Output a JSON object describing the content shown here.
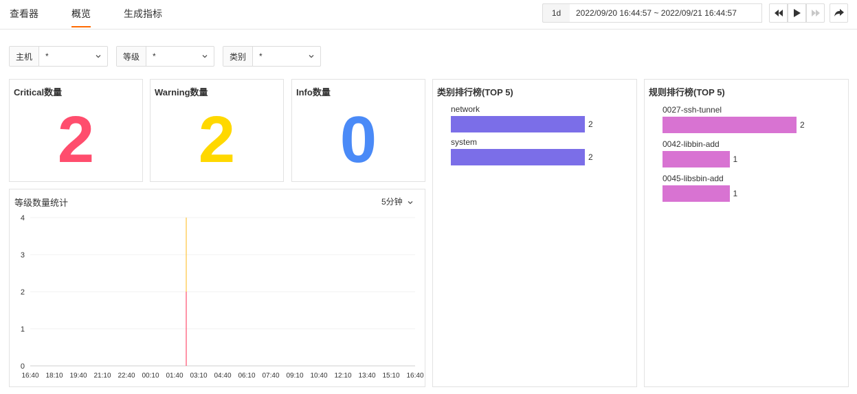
{
  "tabs": [
    {
      "label": "查看器"
    },
    {
      "label": "概览"
    },
    {
      "label": "生成指标"
    }
  ],
  "time_range": {
    "quick": "1d",
    "range_text": "2022/09/20 16:44:57 ~ 2022/09/21 16:44:57"
  },
  "filters": [
    {
      "label": "主机",
      "value": "*"
    },
    {
      "label": "等级",
      "value": "*"
    },
    {
      "label": "类别",
      "value": "*"
    }
  ],
  "stats": [
    {
      "title": "Critical数量",
      "value": "2",
      "color": "#ff4d6d"
    },
    {
      "title": "Warning数量",
      "value": "2",
      "color": "#ffd800"
    },
    {
      "title": "Info数量",
      "value": "0",
      "color": "#4a8af7"
    }
  ],
  "level_chart": {
    "title": "等级数量统计",
    "interval": "5分钟",
    "chart_data": {
      "type": "line",
      "y_ticks": [
        0,
        1,
        2,
        3,
        4
      ],
      "ylim": [
        0,
        4
      ],
      "x_ticks": [
        "16:40",
        "18:10",
        "19:40",
        "21:10",
        "22:40",
        "00:10",
        "01:40",
        "03:10",
        "04:40",
        "06:10",
        "07:40",
        "09:10",
        "10:40",
        "12:10",
        "13:40",
        "15:10",
        "16:40"
      ],
      "spike_at": "01:40",
      "series": [
        {
          "name": "",
          "color": "#ff4d6d",
          "value_at_spike": 2
        },
        {
          "name": "",
          "color": "#ffc53d",
          "value_at_spike": 4
        }
      ]
    }
  },
  "category_rank": {
    "title": "类别排行榜(TOP 5)",
    "color": "#7b6ee8",
    "chart_data": {
      "type": "bar",
      "categories": [
        "network",
        "system"
      ],
      "values": [
        2,
        2
      ],
      "max": 2
    }
  },
  "rule_rank": {
    "title": "规则排行榜(TOP 5)",
    "color": "#d873d2",
    "chart_data": {
      "type": "bar",
      "categories": [
        "0027-ssh-tunnel",
        "0042-libbin-add",
        "0045-libsbin-add"
      ],
      "values": [
        2,
        1,
        1
      ],
      "max": 2
    }
  }
}
